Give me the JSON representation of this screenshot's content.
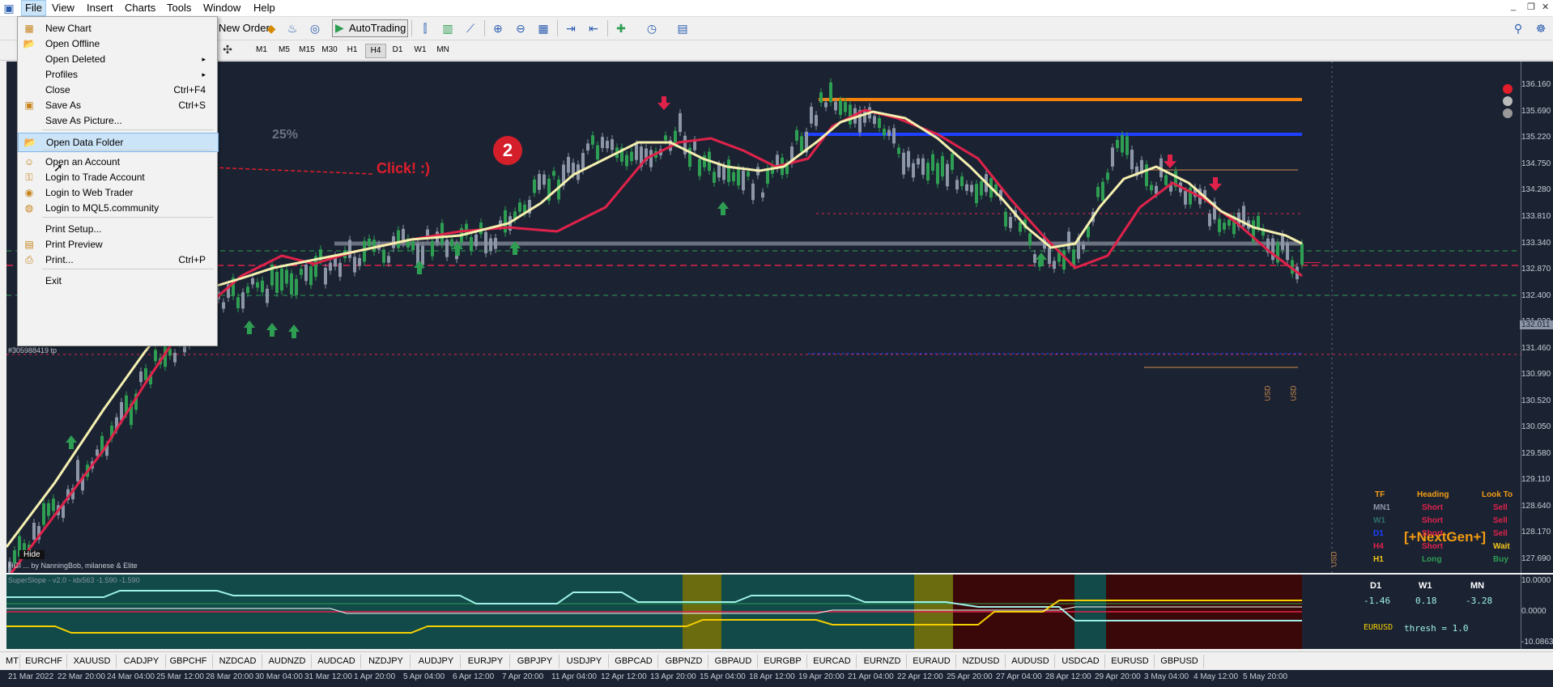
{
  "menubar": {
    "items": [
      "File",
      "View",
      "Insert",
      "Charts",
      "Tools",
      "Window",
      "Help"
    ]
  },
  "toolbar": {
    "new_order": "New Order",
    "autotrading": "AutoTrading",
    "timeframes": [
      "M1",
      "M5",
      "M15",
      "M30",
      "H1",
      "H4",
      "D1",
      "W1",
      "MN"
    ],
    "selected_timeframe": "H4"
  },
  "file_menu": {
    "items": [
      {
        "label": "New Chart",
        "shortcut": "",
        "icon": "new-chart-icon"
      },
      {
        "label": "Open Offline",
        "shortcut": "",
        "icon": "folder-icon"
      },
      {
        "label": "Open Deleted",
        "shortcut": "",
        "submenu": true
      },
      {
        "label": "Profiles",
        "shortcut": "",
        "submenu": true
      },
      {
        "label": "Close",
        "shortcut": "Ctrl+F4"
      },
      {
        "label": "Save As",
        "shortcut": "Ctrl+S",
        "icon": "save-icon"
      },
      {
        "label": "Save As Picture...",
        "shortcut": ""
      },
      {
        "label": "Open Data Folder",
        "shortcut": "",
        "icon": "folder-icon",
        "highlighted": true
      },
      {
        "label": "Open an Account",
        "shortcut": "",
        "icon": "account-icon"
      },
      {
        "label": "Login to Trade Account",
        "shortcut": "",
        "icon": "login-icon"
      },
      {
        "label": "Login to Web Trader",
        "shortcut": "",
        "icon": "web-icon"
      },
      {
        "label": "Login to MQL5.community",
        "shortcut": "",
        "icon": "mql5-icon"
      },
      {
        "label": "Print Setup...",
        "shortcut": ""
      },
      {
        "label": "Print Preview",
        "shortcut": "",
        "icon": "print-preview-icon"
      },
      {
        "label": "Print...",
        "shortcut": "Ctrl+P",
        "icon": "printer-icon"
      },
      {
        "label": "Exit",
        "shortcut": ""
      }
    ]
  },
  "annotation": {
    "click_text": "Click! :)",
    "step_badge": "2"
  },
  "chart": {
    "zoom_label": "25%",
    "trade_label": "#305988419 tp",
    "hide_label": "Hide",
    "credit_text": "HGI ... by NanningBob, milanese & Elite",
    "currency_tag": "USD",
    "colors": {
      "background": "#1b2333",
      "bull": "#2e9e52",
      "bear": "#8c96a6",
      "ma_fast": "#f5f0b0",
      "ma_slow": "#e0224a"
    },
    "prices": [
      "136.160",
      "135.690",
      "135.220",
      "134.750",
      "134.280",
      "133.810",
      "133.340",
      "132.870",
      "132.400",
      "131.930",
      "131.460",
      "130.990",
      "130.520",
      "130.050",
      "129.580",
      "129.110",
      "128.640",
      "128.170",
      "127.690"
    ],
    "current_price": "132.011"
  },
  "dashboard": {
    "title": "[+NextGen+]",
    "headers": [
      "TF",
      "Heading",
      "Look To"
    ],
    "rows": [
      {
        "tf": "MN1",
        "heading": "Short",
        "look": "Sell",
        "tf_color": "#8c96a6",
        "heading_color": "#e0224a",
        "look_color": "#e0224a"
      },
      {
        "tf": "W1",
        "heading": "Short",
        "look": "Sell",
        "tf_color": "#2e6e6e",
        "heading_color": "#e0224a",
        "look_color": "#e0224a"
      },
      {
        "tf": "D1",
        "heading": "Short",
        "look": "Sell",
        "tf_color": "#1e40ff",
        "heading_color": "#e0224a",
        "look_color": "#e0224a"
      },
      {
        "tf": "H4",
        "heading": "Short",
        "look": "Wait",
        "tf_color": "#e0224a",
        "heading_color": "#e0224a",
        "look_color": "#f5c518"
      },
      {
        "tf": "H1",
        "heading": "Long",
        "look": "Buy",
        "tf_color": "#f5c518",
        "heading_color": "#2e9e52",
        "look_color": "#2e9e52"
      }
    ]
  },
  "indicator": {
    "label": "SuperSlope - v2.0 - idx563 -1.590 -1.590",
    "headers": [
      "D1",
      "W1",
      "MN"
    ],
    "values": [
      "-1.46",
      "0.18",
      "-3.28"
    ],
    "thresh": "thresh = 1.0",
    "pair_label": "EURUSD",
    "axis": [
      "10.0000",
      "0.0000",
      "-10.0863"
    ]
  },
  "symbols": [
    "EURCHF",
    "XAUUSD",
    "CADJPY",
    "GBPCHF",
    "NZDCAD",
    "AUDNZD",
    "AUDCAD",
    "NZDJPY",
    "AUDJPY",
    "EURJPY",
    "GBPJPY",
    "USDJPY",
    "GBPCAD",
    "GBPNZD",
    "GBPAUD",
    "EURGBP",
    "EURCAD",
    "EURNZD",
    "EURAUD",
    "NZDUSD",
    "AUDUSD",
    "USDCAD",
    "EURUSD",
    "GBPUSD"
  ],
  "mt_label": "MT",
  "dates": [
    "21 Mar 2022",
    "22 Mar 20:00",
    "24 Mar 04:00",
    "25 Mar 12:00",
    "28 Mar 20:00",
    "30 Mar 04:00",
    "31 Mar 12:00",
    "1 Apr 20:00",
    "5 Apr 04:00",
    "6 Apr 12:00",
    "7 Apr 20:00",
    "11 Apr 04:00",
    "12 Apr 12:00",
    "13 Apr 20:00",
    "15 Apr 04:00",
    "18 Apr 12:00",
    "19 Apr 20:00",
    "21 Apr 04:00",
    "22 Apr 12:00",
    "25 Apr 20:00",
    "27 Apr 04:00",
    "28 Apr 12:00",
    "29 Apr 20:00",
    "3 May 04:00",
    "4 May 12:00",
    "5 May 20:00"
  ]
}
